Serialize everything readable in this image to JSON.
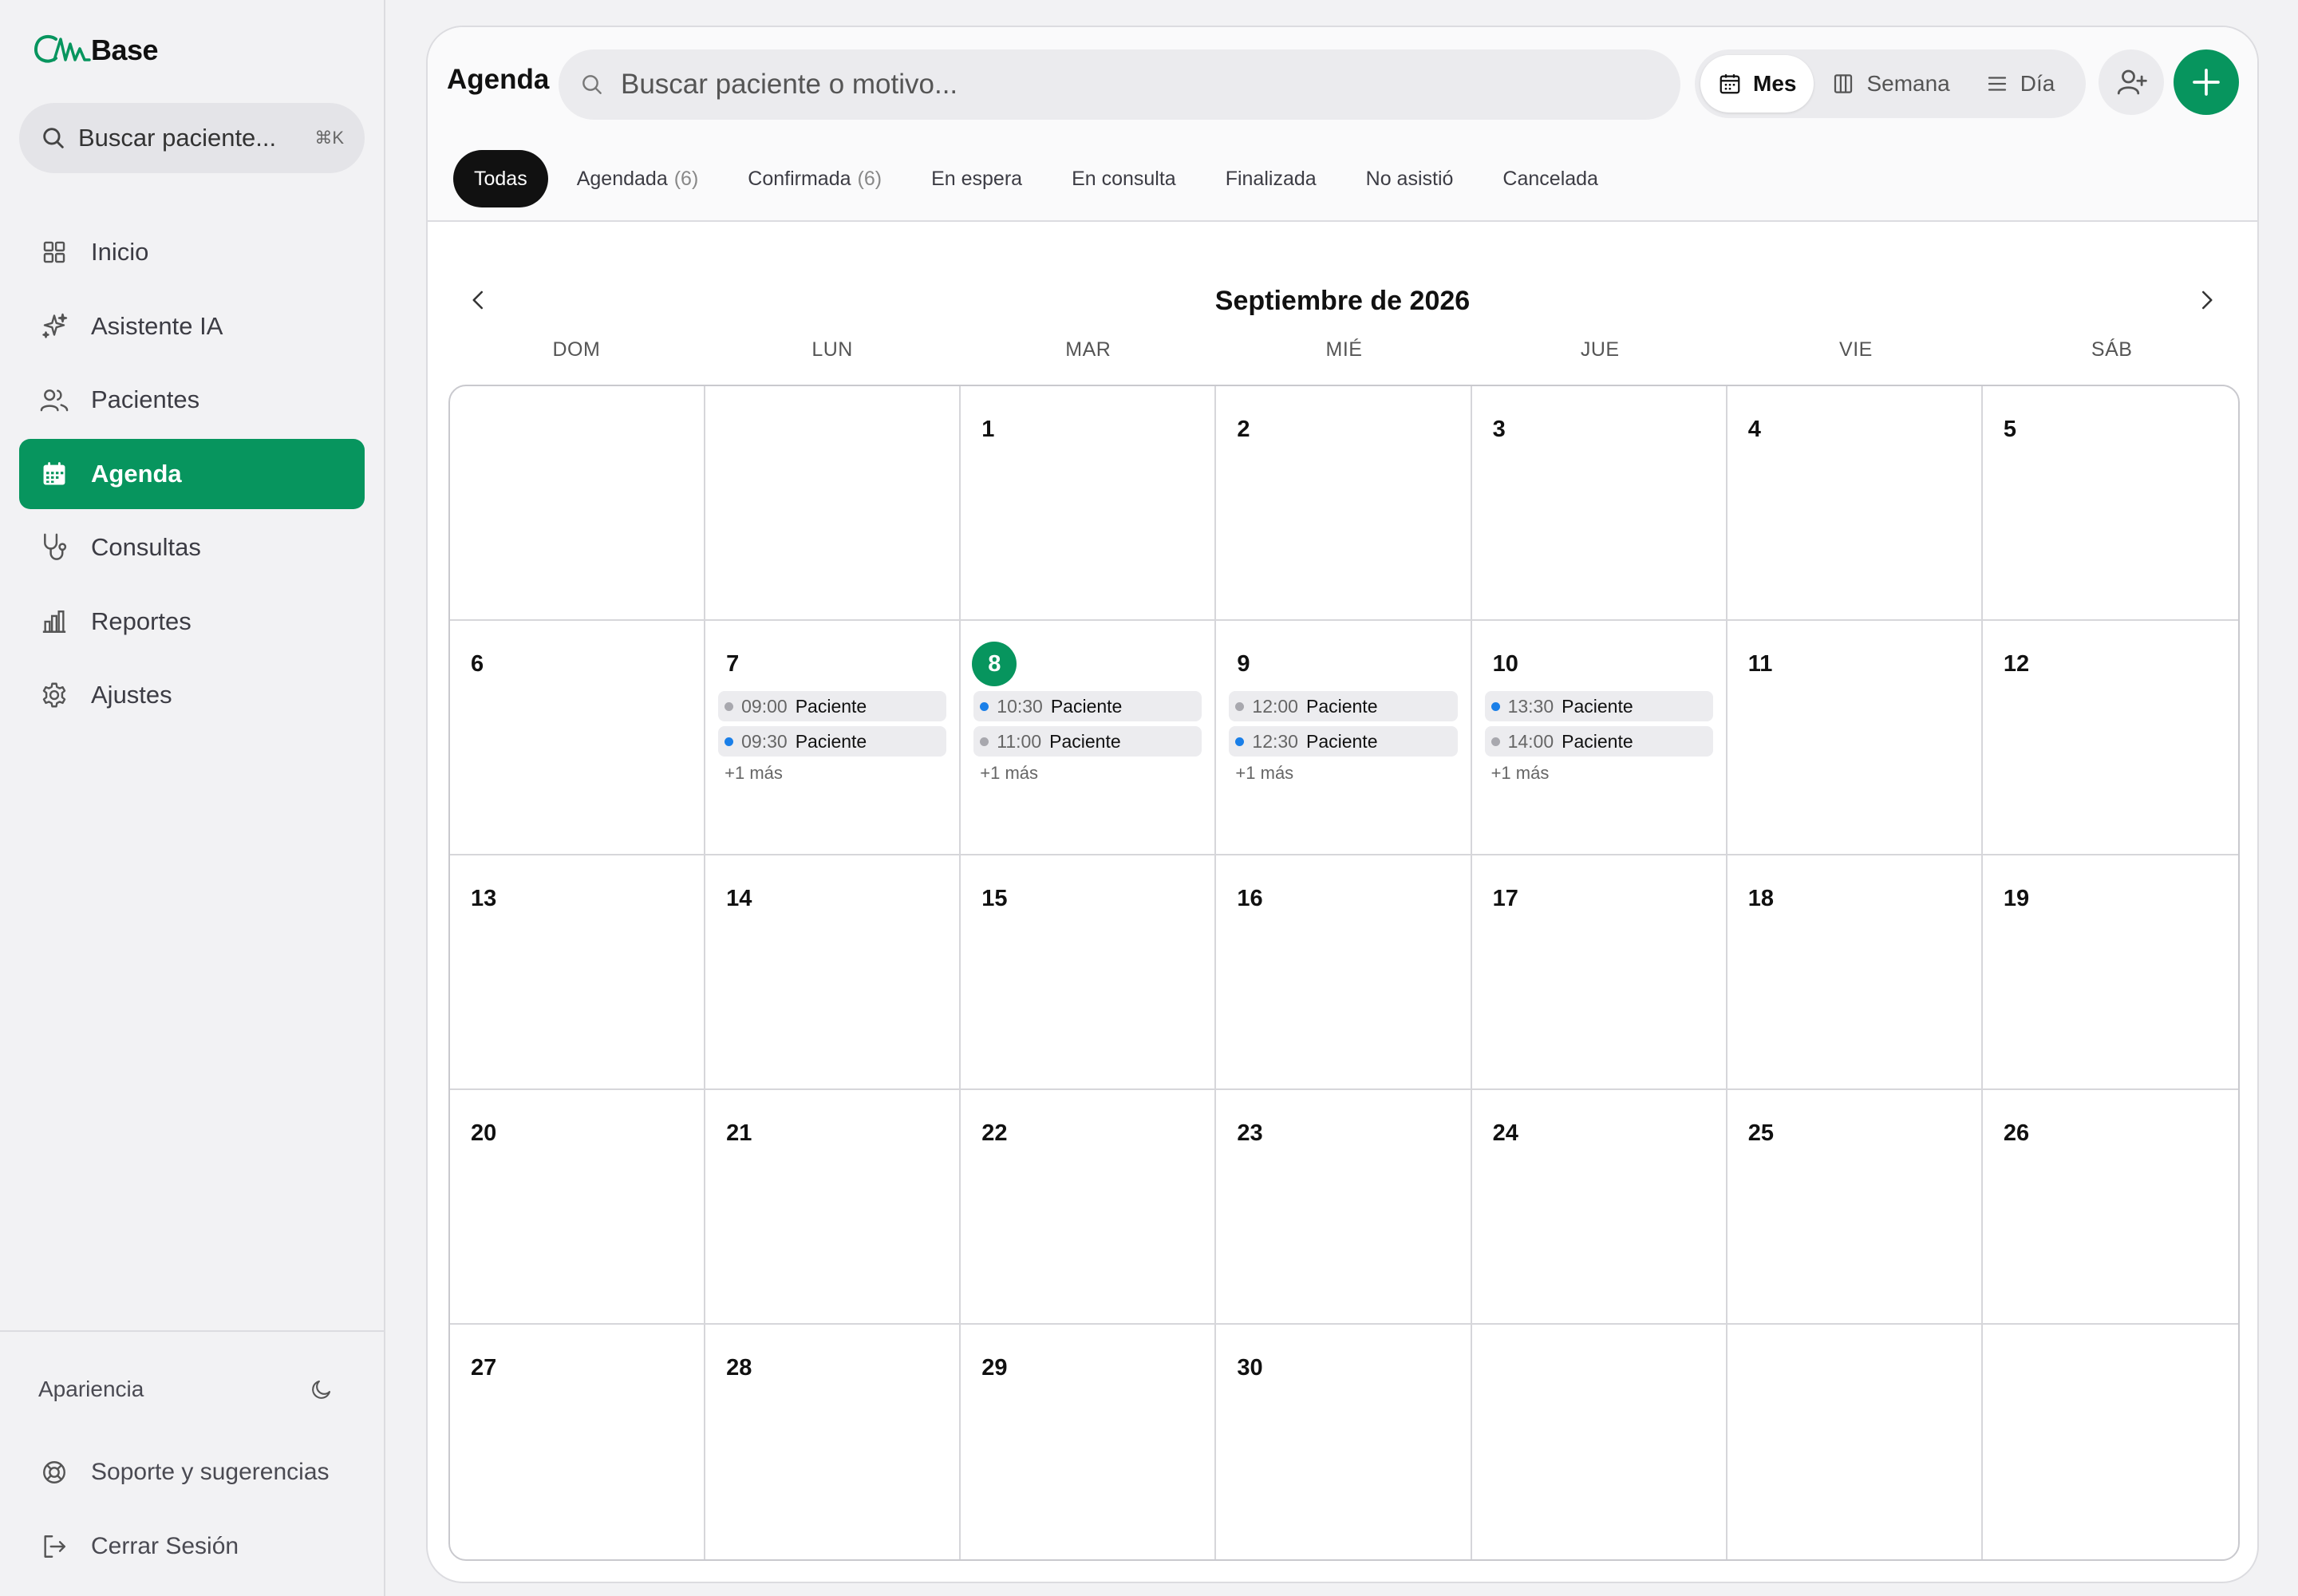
{
  "app": {
    "logo_text": "Base",
    "brand_color": "#07955e"
  },
  "sidebar": {
    "search_placeholder": "Buscar paciente...",
    "search_shortcut": "⌘K",
    "items": [
      {
        "label": "Inicio",
        "icon": "grid-icon"
      },
      {
        "label": "Asistente IA",
        "icon": "sparkles-icon"
      },
      {
        "label": "Pacientes",
        "icon": "users-icon"
      },
      {
        "label": "Agenda",
        "icon": "calendar-icon",
        "active": true
      },
      {
        "label": "Consultas",
        "icon": "stethoscope-icon"
      },
      {
        "label": "Reportes",
        "icon": "bar-chart-icon"
      },
      {
        "label": "Ajustes",
        "icon": "gear-icon"
      }
    ],
    "appearance_label": "Apariencia",
    "support_label": "Soporte y sugerencias",
    "logout_label": "Cerrar Sesión"
  },
  "header": {
    "title": "Agenda",
    "search_placeholder": "Buscar paciente o motivo...",
    "views": [
      {
        "label": "Mes",
        "active": true
      },
      {
        "label": "Semana",
        "active": false
      },
      {
        "label": "Día",
        "active": false
      }
    ],
    "filters": [
      {
        "label": "Todas",
        "count": "",
        "active": true
      },
      {
        "label": "Agendada",
        "count": "(6)",
        "active": false
      },
      {
        "label": "Confirmada",
        "count": "(6)",
        "active": false
      },
      {
        "label": "En espera",
        "count": "",
        "active": false
      },
      {
        "label": "En consulta",
        "count": "",
        "active": false
      },
      {
        "label": "Finalizada",
        "count": "",
        "active": false
      },
      {
        "label": "No asistió",
        "count": "",
        "active": false
      },
      {
        "label": "Cancelada",
        "count": "",
        "active": false
      }
    ]
  },
  "calendar": {
    "month_title": "Septiembre de 2026",
    "weekdays": [
      "DOM",
      "LUN",
      "MAR",
      "MIÉ",
      "JUE",
      "VIE",
      "SÁB"
    ],
    "status_colors": {
      "agendada": "#a8a8ae",
      "confirmada": "#1a7fe8"
    },
    "today": "8",
    "weeks": [
      [
        "",
        "",
        "1",
        "2",
        "3",
        "4",
        "5"
      ],
      [
        "6",
        "7",
        "8",
        "9",
        "10",
        "11",
        "12"
      ],
      [
        "13",
        "14",
        "15",
        "16",
        "17",
        "18",
        "19"
      ],
      [
        "20",
        "21",
        "22",
        "23",
        "24",
        "25",
        "26"
      ],
      [
        "27",
        "28",
        "29",
        "30",
        "",
        "",
        ""
      ]
    ],
    "appointments": {
      "7": {
        "items": [
          {
            "time": "09:00",
            "name": "Paciente",
            "status": "agendada"
          },
          {
            "time": "09:30",
            "name": "Paciente",
            "status": "confirmada"
          }
        ],
        "more": "+1 más"
      },
      "8": {
        "items": [
          {
            "time": "10:30",
            "name": "Paciente",
            "status": "confirmada"
          },
          {
            "time": "11:00",
            "name": "Paciente",
            "status": "agendada"
          }
        ],
        "more": "+1 más"
      },
      "9": {
        "items": [
          {
            "time": "12:00",
            "name": "Paciente",
            "status": "agendada"
          },
          {
            "time": "12:30",
            "name": "Paciente",
            "status": "confirmada"
          }
        ],
        "more": "+1 más"
      },
      "10": {
        "items": [
          {
            "time": "13:30",
            "name": "Paciente",
            "status": "confirmada"
          },
          {
            "time": "14:00",
            "name": "Paciente",
            "status": "agendada"
          }
        ],
        "more": "+1 más"
      }
    }
  }
}
